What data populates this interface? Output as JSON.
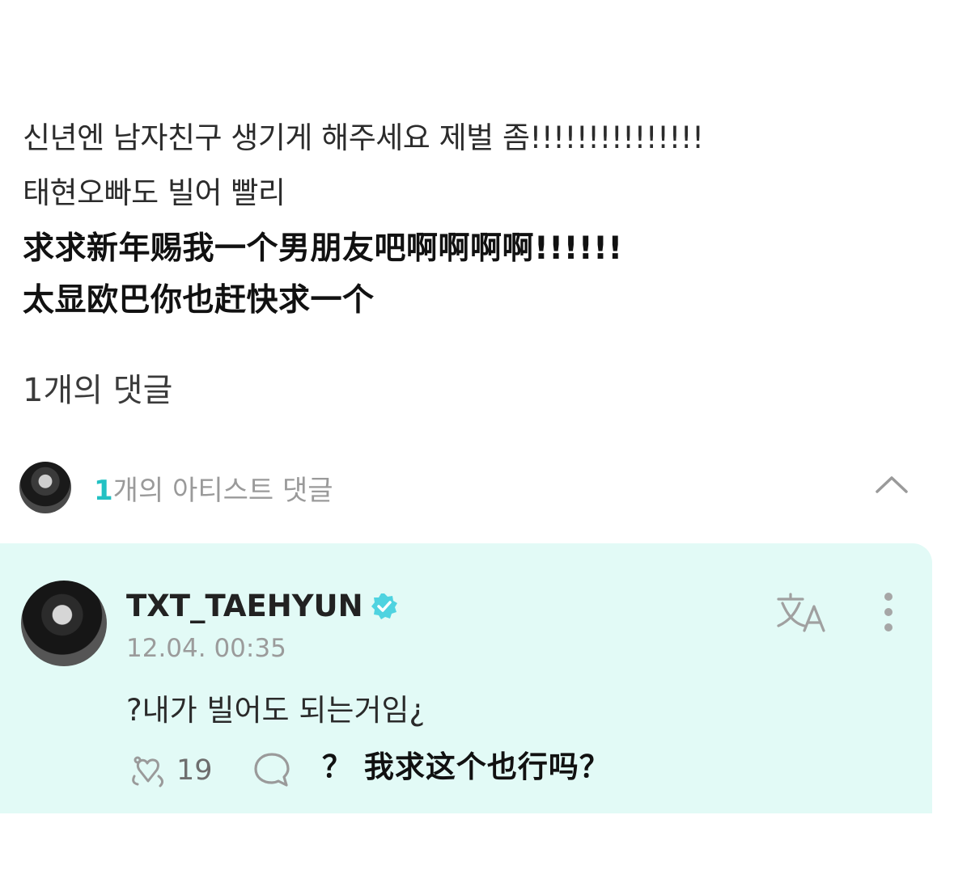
{
  "post": {
    "line1": "신년엔 남자친구 생기게 해주세요 제벌 좀!!!!!!!!!!!!!!!",
    "line2": "태현오빠도 빌어 빨리",
    "overlay_line1": "求求新年赐我一个男朋友吧啊啊啊啊!!!!!!",
    "overlay_line2": "太显欧巴你也赶快求一个"
  },
  "comments": {
    "count_label": "1개의 댓글",
    "artist_count_num": "1",
    "artist_count_text": "개의 아티스트 댓글"
  },
  "artist_comment": {
    "username": "TXT_TAEHYUN",
    "timestamp": "12.04. 00:35",
    "text": "?내가 빌어도 되는거임¿",
    "like_count": "19",
    "overlay_translation": "？ 我求这个也行吗？"
  },
  "icons": {
    "verified": "verified-badge-icon",
    "translate": "translate-icon",
    "more": "more-vertical-icon",
    "like": "like-icon",
    "reply": "reply-bubble-icon",
    "collapse": "chevron-up-icon"
  },
  "colors": {
    "accent": "#22c1c3",
    "card_background": "#e2faf6"
  }
}
